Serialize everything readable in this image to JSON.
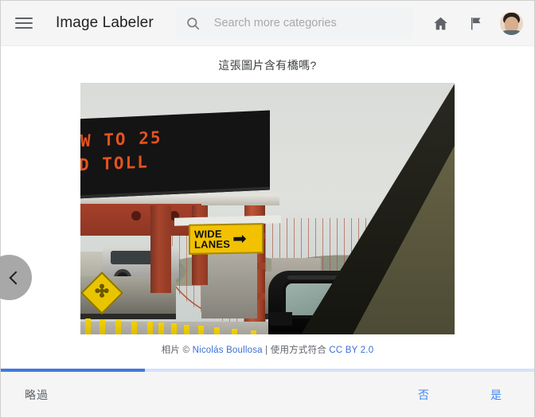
{
  "header": {
    "menu_icon": "hamburger-menu-icon",
    "title": "Image Labeler",
    "search": {
      "icon": "search-icon",
      "value": "",
      "placeholder": "Search more categories"
    },
    "home_icon": "home-icon",
    "flag_icon": "flag-icon",
    "avatar": "user-avatar"
  },
  "main": {
    "question": "這張圖片含有橋嗎?",
    "prev_icon": "chevron-left-icon",
    "photo": {
      "alt": "Golden Gate Bridge toll plaza seen from a car window",
      "vms_line1": "W TO 25",
      "vms_line2": "D TOLL",
      "wide_lanes_line1": "WIDE",
      "wide_lanes_line2": "LANES",
      "wide_lanes_arrow": "➡"
    },
    "caption": {
      "prefix": "相片 © ",
      "author": "Nicolás Boullosa",
      "separator": " | ",
      "usage": "使用方式符合 ",
      "license": "CC BY 2.0"
    }
  },
  "footer": {
    "progress_percent": 27,
    "skip_label": "略過",
    "no_label": "否",
    "yes_label": "是"
  },
  "colors": {
    "accent_blue": "#4285f4",
    "progress_fill": "#4279e0",
    "progress_track": "#d6e2fb",
    "link_blue": "#3b6fd4",
    "bar_bg": "#f5f5f5",
    "search_bg": "#f1f3f4",
    "text_primary": "#202124",
    "text_secondary": "#5f6368"
  }
}
